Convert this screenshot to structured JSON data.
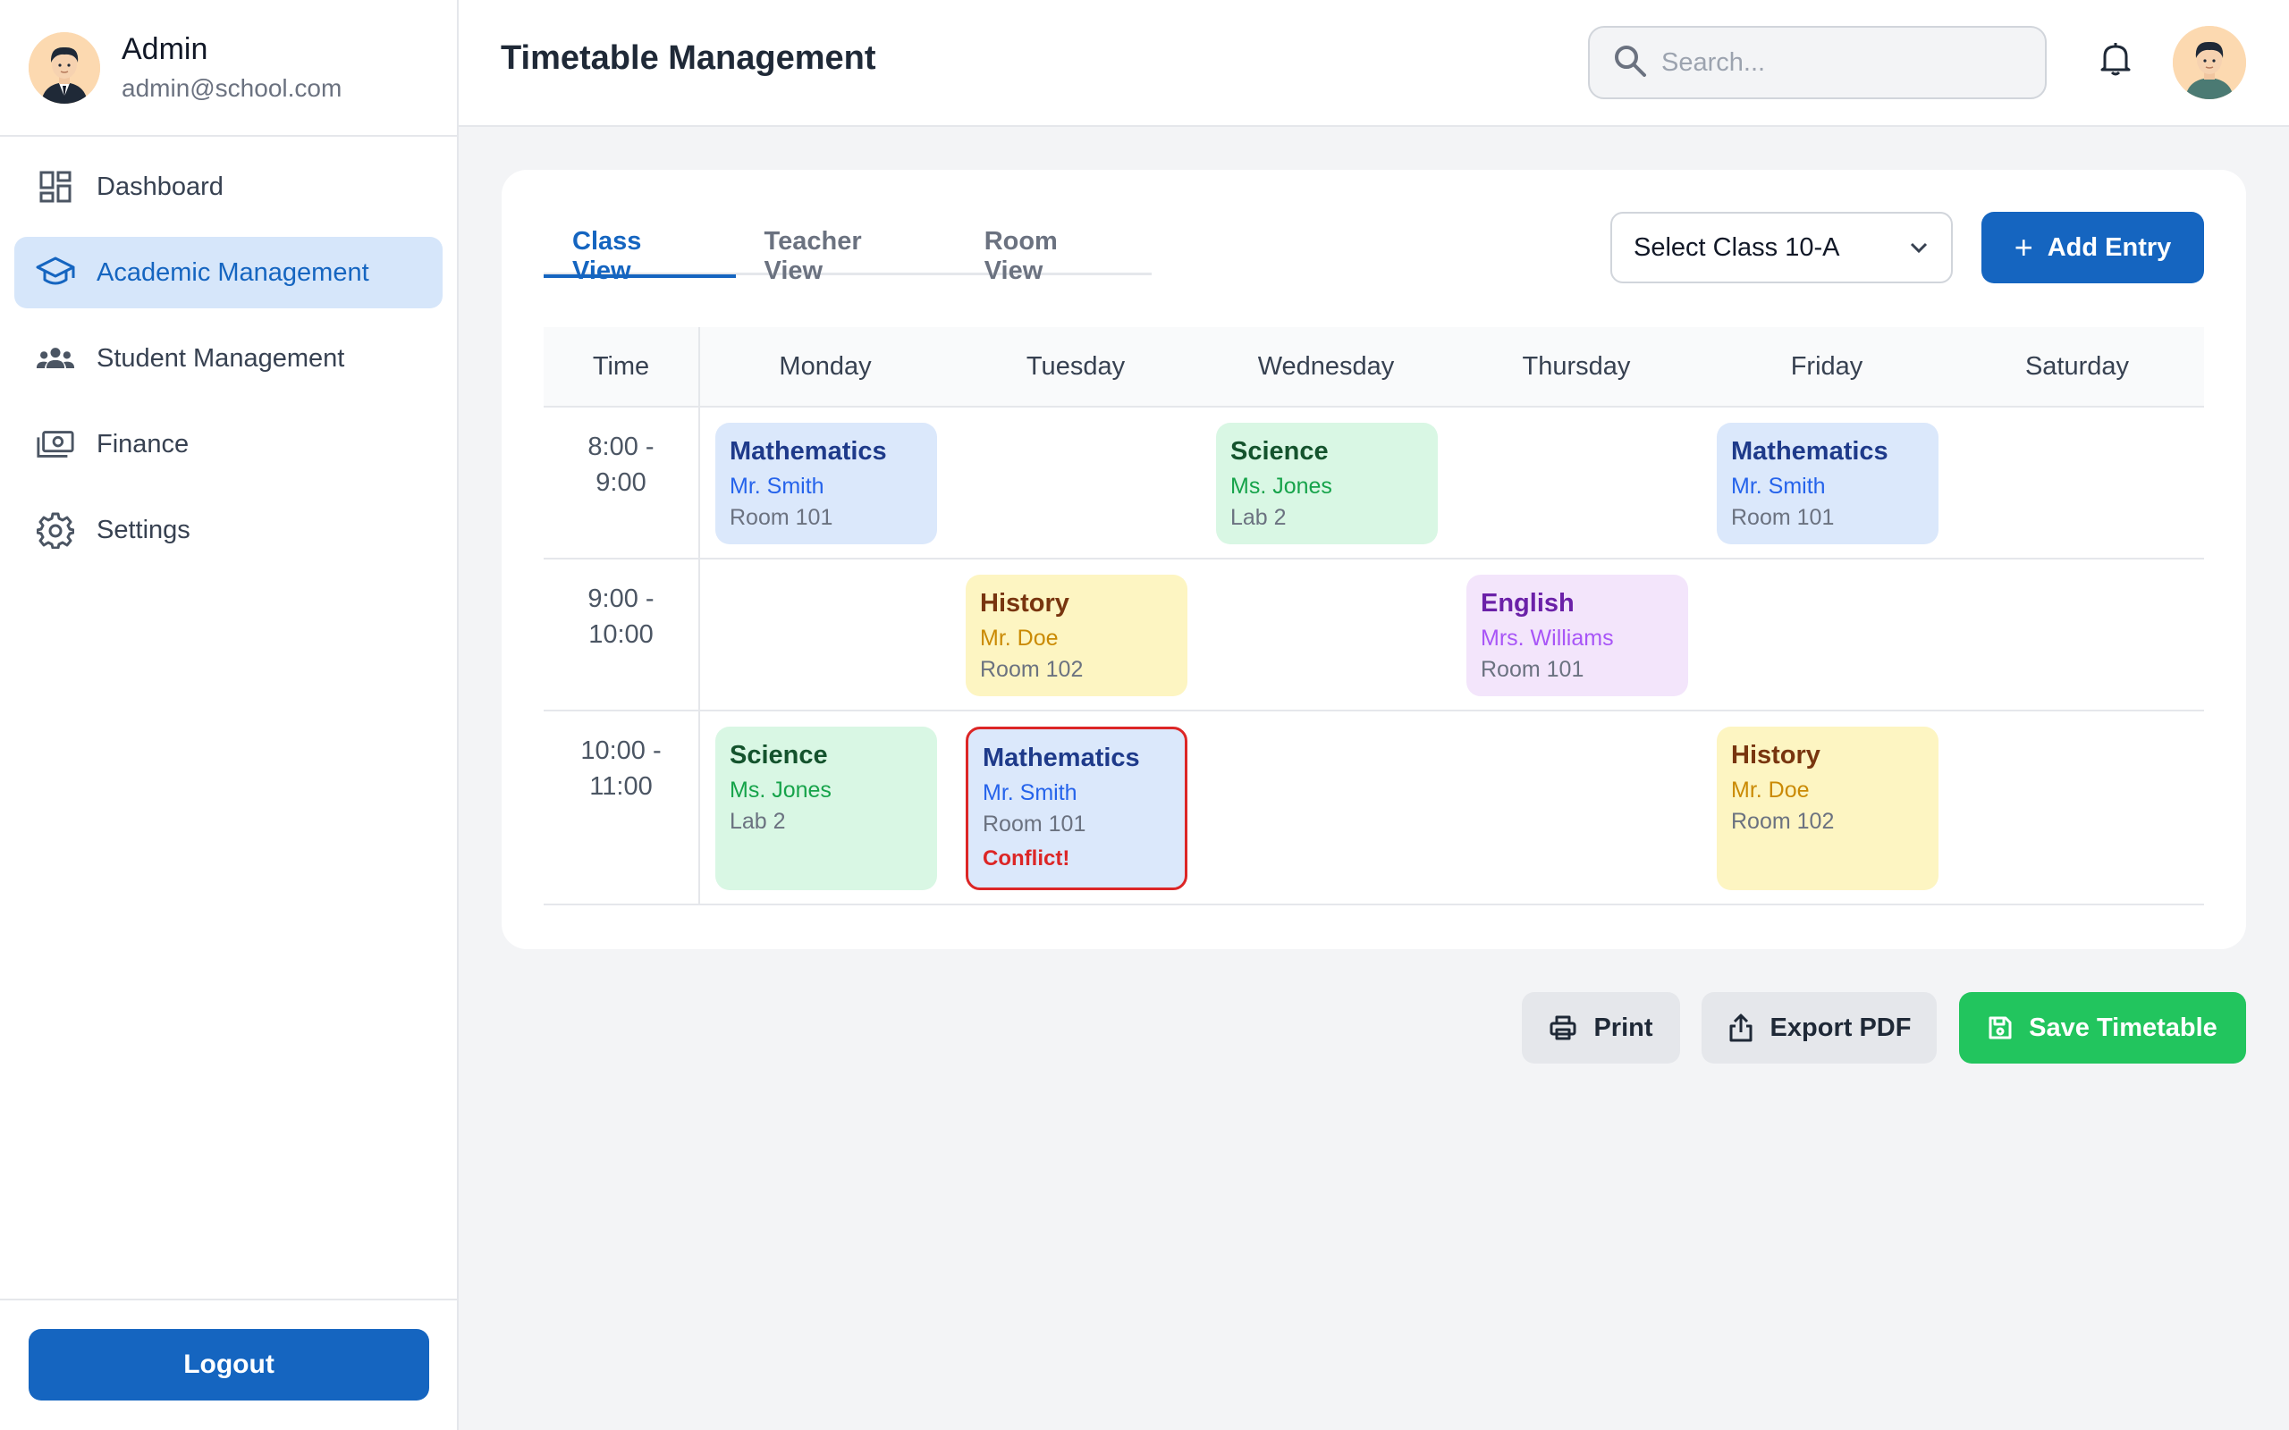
{
  "sidebar": {
    "user": {
      "name": "Admin",
      "email": "admin@school.com"
    },
    "items": [
      {
        "label": "Dashboard",
        "icon": "dashboard-icon",
        "active": false
      },
      {
        "label": "Academic Management",
        "icon": "graduation-cap-icon",
        "active": true
      },
      {
        "label": "Student Management",
        "icon": "people-icon",
        "active": false
      },
      {
        "label": "Finance",
        "icon": "money-icon",
        "active": false
      },
      {
        "label": "Settings",
        "icon": "gear-icon",
        "active": false
      }
    ],
    "logout_label": "Logout"
  },
  "header": {
    "title": "Timetable Management",
    "search_placeholder": "Search..."
  },
  "timetable": {
    "tabs": [
      {
        "label": "Class View",
        "active": true
      },
      {
        "label": "Teacher View",
        "active": false
      },
      {
        "label": "Room View",
        "active": false
      }
    ],
    "class_select": "Select Class 10-A",
    "add_label": "Add Entry",
    "columns": [
      "Time",
      "Monday",
      "Tuesday",
      "Wednesday",
      "Thursday",
      "Friday",
      "Saturday"
    ],
    "rows": [
      {
        "time": [
          "8:00 -",
          "9:00"
        ],
        "entries": [
          {
            "subject": "Mathematics",
            "teacher": "Mr. Smith",
            "room": "Room 101"
          },
          null,
          {
            "subject": "Science",
            "teacher": "Ms. Jones",
            "room": "Lab 2"
          },
          null,
          {
            "subject": "Mathematics",
            "teacher": "Mr. Smith",
            "room": "Room 101"
          },
          null
        ]
      },
      {
        "time": [
          "9:00 -",
          "10:00"
        ],
        "entries": [
          null,
          {
            "subject": "History",
            "teacher": "Mr. Doe",
            "room": "Room 102"
          },
          null,
          {
            "subject": "English",
            "teacher": "Mrs. Williams",
            "room": "Room 101"
          },
          null,
          null
        ]
      },
      {
        "time": [
          "10:00 -",
          "11:00"
        ],
        "entries": [
          {
            "subject": "Science",
            "teacher": "Ms. Jones",
            "room": "Lab 2"
          },
          {
            "subject": "Mathematics",
            "teacher": "Mr. Smith",
            "room": "Room 101",
            "conflict": "Conflict!"
          },
          null,
          null,
          {
            "subject": "History",
            "teacher": "Mr. Doe",
            "room": "Room 102"
          },
          null
        ]
      }
    ]
  },
  "actions": {
    "print_label": "Print",
    "export_label": "Export PDF",
    "save_label": "Save Timetable"
  },
  "colors": {
    "primary": "#1565c0",
    "success": "#22c55e",
    "conflict": "#dc2626",
    "math": "#dbe8fb",
    "science": "#d9f7e4",
    "history": "#fdf5c2",
    "english": "#f3e5fb"
  }
}
